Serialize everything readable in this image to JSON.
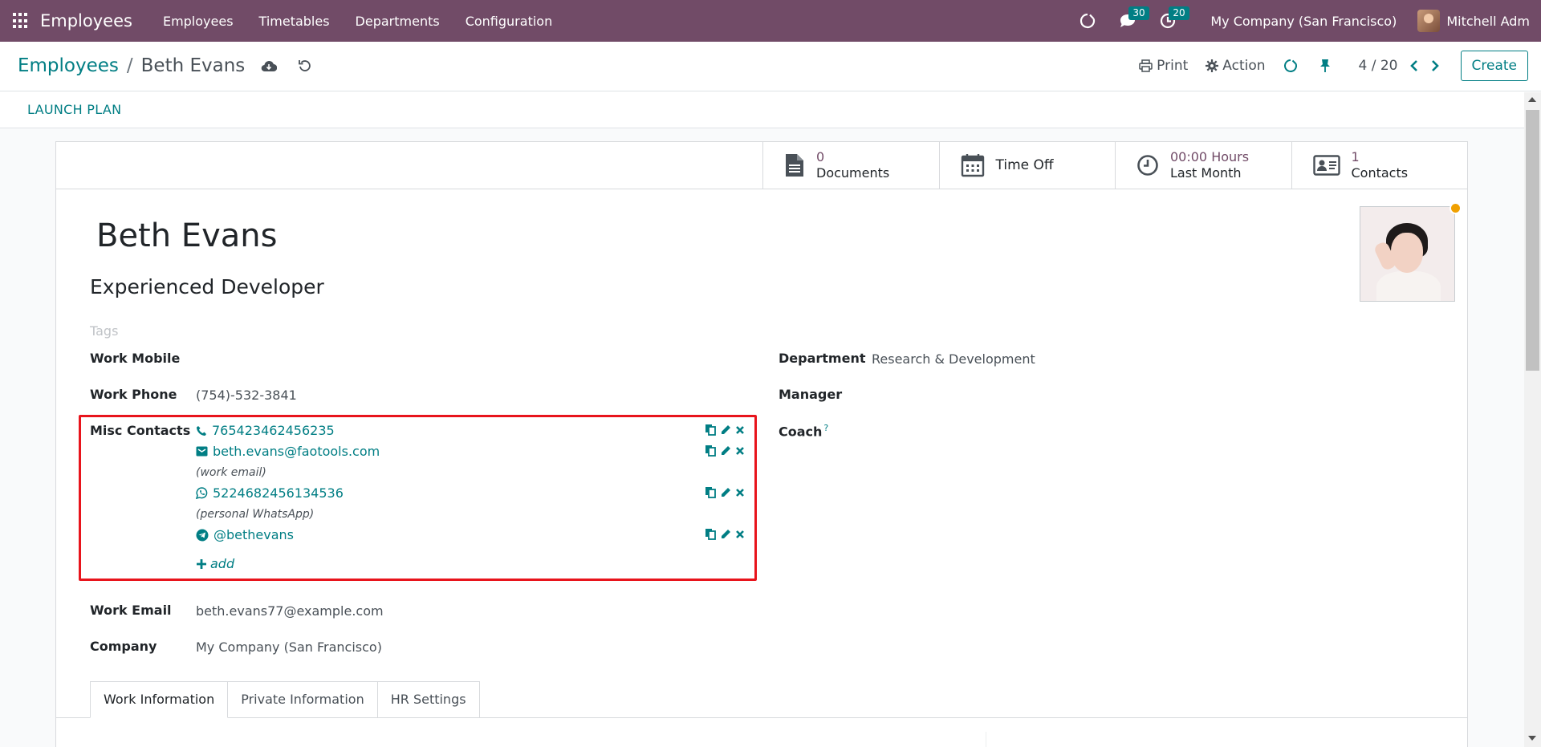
{
  "navbar": {
    "app_name": "Employees",
    "menu": [
      "Employees",
      "Timetables",
      "Departments",
      "Configuration"
    ],
    "messages_count": "30",
    "activities_count": "20",
    "company": "My Company (San Francisco)",
    "user": "Mitchell Adm"
  },
  "breadcrumb": {
    "parent": "Employees",
    "separator": "/",
    "current": "Beth Evans"
  },
  "control_panel": {
    "print": "Print",
    "action": "Action",
    "pager": "4 / 20",
    "create": "Create"
  },
  "statusbar": {
    "launch_plan": "LAUNCH PLAN"
  },
  "smart_buttons": [
    {
      "value": "0",
      "label": "Documents",
      "icon": "document-icon"
    },
    {
      "value": "",
      "label": "Time Off",
      "icon": "calendar-icon"
    },
    {
      "value": "00:00 Hours",
      "label": "Last Month",
      "icon": "clock-icon"
    },
    {
      "value": "1",
      "label": "Contacts",
      "icon": "contact-card-icon"
    }
  ],
  "employee": {
    "name": "Beth Evans",
    "job_title": "Experienced Developer",
    "tags_placeholder": "Tags"
  },
  "fields": {
    "work_mobile": {
      "label": "Work Mobile",
      "value": ""
    },
    "work_phone": {
      "label": "Work Phone",
      "value": "(754)-532-3841"
    },
    "misc_contacts": {
      "label": "Misc Contacts"
    },
    "work_email": {
      "label": "Work Email",
      "value": "beth.evans77@example.com"
    },
    "company": {
      "label": "Company",
      "value": "My Company (San Francisco)"
    },
    "department": {
      "label": "Department",
      "value": "Research & Development"
    },
    "manager": {
      "label": "Manager",
      "value": ""
    },
    "coach": {
      "label": "Coach",
      "help": "?"
    }
  },
  "misc_contacts": [
    {
      "type": "phone",
      "icon": "phone-icon",
      "value": "765423462456235",
      "note": ""
    },
    {
      "type": "email",
      "icon": "envelope-icon",
      "value": "beth.evans@faotools.com",
      "note": "(work email)"
    },
    {
      "type": "whatsapp",
      "icon": "whatsapp-icon",
      "value": "5224682456134536",
      "note": "(personal WhatsApp)"
    },
    {
      "type": "telegram",
      "icon": "telegram-icon",
      "value": "@bethevans",
      "note": ""
    }
  ],
  "misc_add_label": "add",
  "tabs": [
    "Work Information",
    "Private Information",
    "HR Settings"
  ],
  "colors": {
    "navbar": "#714b67",
    "accent": "#017e84",
    "highlight_box": "#e8141c",
    "online": "#f0a000"
  }
}
